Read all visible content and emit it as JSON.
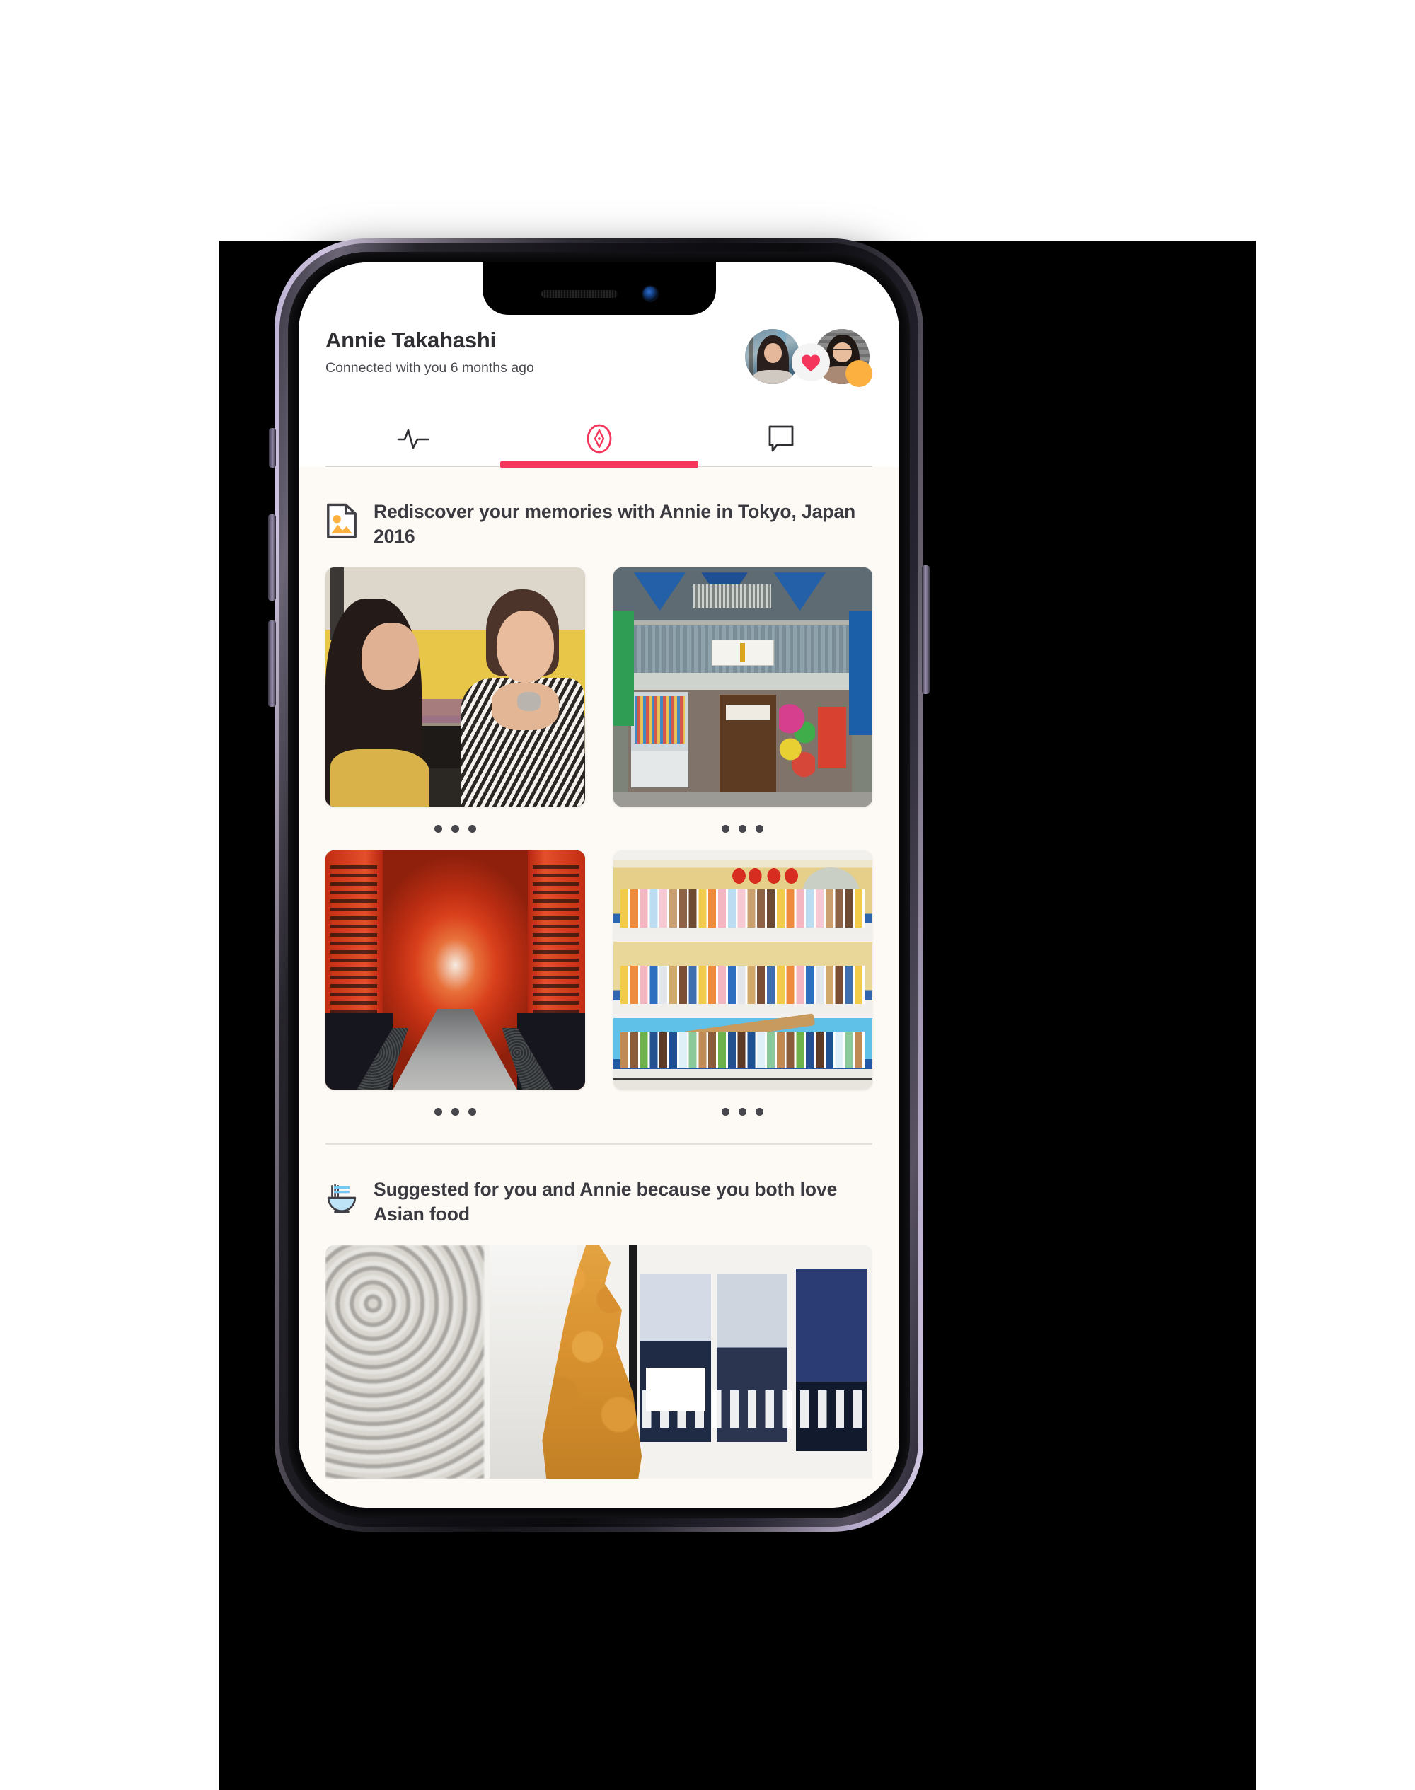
{
  "app": {
    "profile": {
      "name": "Annie Takahashi",
      "connection_status": "Connected with you 6 months ago",
      "avatar_1_name": "you-avatar",
      "avatar_2_name": "annie-avatar",
      "badge_icon": "heart-icon",
      "badge_color": "#F5365C",
      "status_dot_color": "#FBB040"
    },
    "tabs": [
      {
        "id": "activity",
        "icon": "pulse-icon",
        "active": false
      },
      {
        "id": "discover",
        "icon": "compass-icon",
        "active": true
      },
      {
        "id": "messages",
        "icon": "chat-bubble-icon",
        "active": false
      }
    ],
    "accent_color": "#F5365C",
    "content_background": "#FDFAF5",
    "sections": [
      {
        "id": "memories",
        "icon": "photo-document-icon",
        "icon_color": "#FBB040",
        "title": "Rediscover your memories with Annie in Tokyo, Japan 2016",
        "overflow_label": "•••",
        "photos": [
          {
            "id": "photo-two-women-yellow-wall",
            "alt": "Two women talking in front of a yellow painted wall"
          },
          {
            "id": "photo-japanese-storefront",
            "alt": "Japanese storefront with vending machine and banners"
          },
          {
            "id": "photo-torii-gates",
            "alt": "Red torii gate tunnel at Fushimi Inari shrine"
          },
          {
            "id": "photo-vending-machine",
            "alt": "Japanese drink vending machine display"
          }
        ]
      },
      {
        "id": "suggested",
        "icon": "noodle-bowl-icon",
        "icon_color": "#74C7F0",
        "title": "Suggested for you and Annie because you both love Asian food",
        "photos": [
          {
            "id": "photo-fried-chicken",
            "alt": "Fried chicken on a stick with blurred city street behind"
          }
        ]
      }
    ]
  },
  "device": {
    "frame_color": "#C5B8D8",
    "notch_speaker": "speaker-grille",
    "notch_camera": "front-camera-lens",
    "buttons": [
      "mute-switch",
      "volume-up",
      "volume-down",
      "power"
    ]
  }
}
